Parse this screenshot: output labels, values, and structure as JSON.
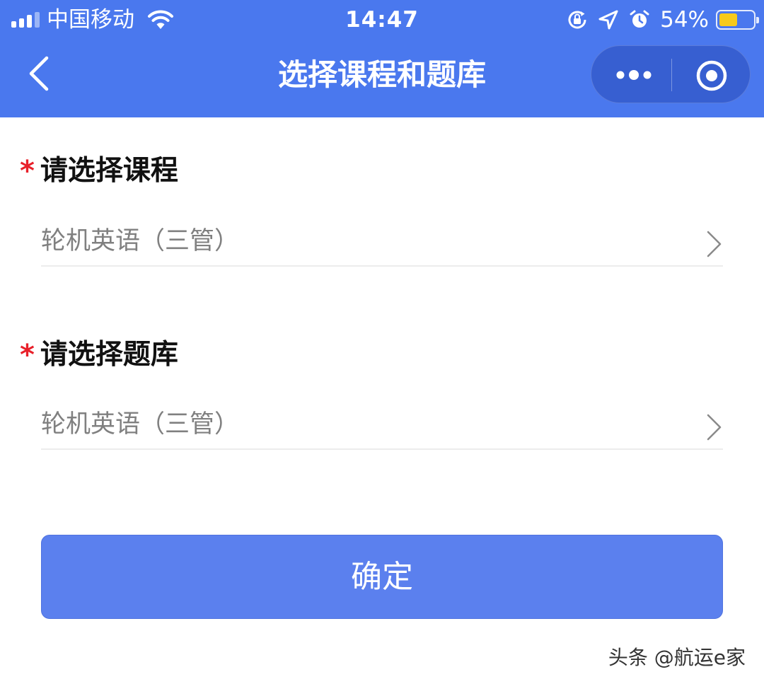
{
  "status_bar": {
    "carrier": "中国移动",
    "time": "14:47",
    "battery_percent": "54%",
    "battery_level": 0.54,
    "icons": [
      "signal-icon",
      "wifi-icon",
      "orientation-lock-icon",
      "location-icon",
      "alarm-icon",
      "battery-icon"
    ]
  },
  "nav": {
    "title": "选择课程和题库",
    "back_icon": "chevron-left-icon",
    "capsule_icons": [
      "more-dots-icon",
      "close-circle-icon"
    ]
  },
  "form": {
    "required_mark": "*",
    "course": {
      "label": "请选择课程",
      "value": "轮机英语（三管）"
    },
    "bank": {
      "label": "请选择题库",
      "value": "轮机英语（三管）"
    }
  },
  "confirm_button": "确定",
  "watermark": "头条 @航运e家",
  "colors": {
    "header": "#4a78ee",
    "button": "#5b80ee",
    "required": "#e8202a",
    "battery_fill": "#f7ca1a"
  }
}
